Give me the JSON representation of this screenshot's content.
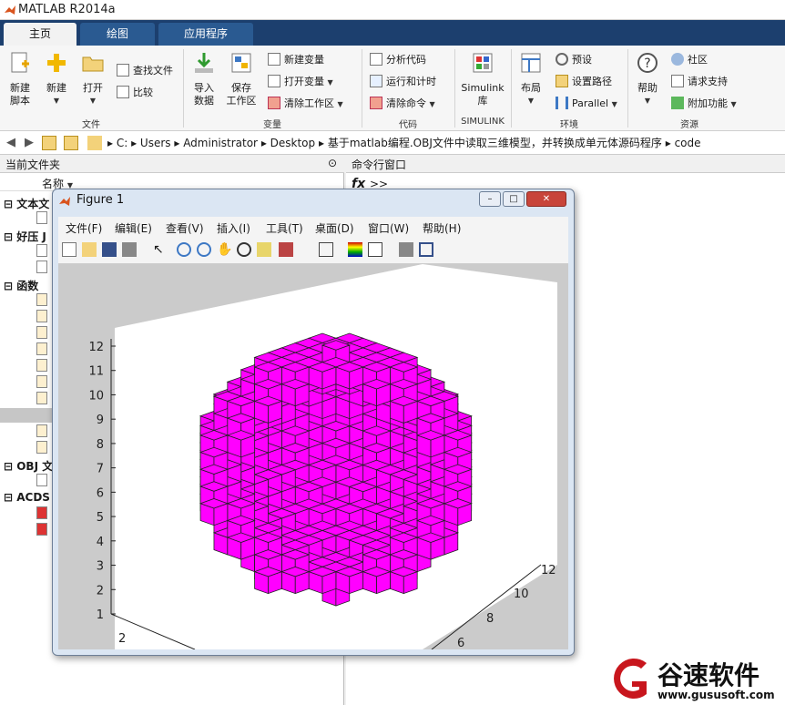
{
  "app": {
    "title": "MATLAB R2014a"
  },
  "tabs": [
    "主页",
    "绘图",
    "应用程序"
  ],
  "ribbon": {
    "file": {
      "new_script": "新建\n脚本",
      "new": "新建",
      "open": "打开",
      "find_files": "查找文件",
      "compare": "比较",
      "group": "文件"
    },
    "variable": {
      "import": "导入\n数据",
      "save_ws": "保存\n工作区",
      "new_var": "新建变量",
      "open_var": "打开变量",
      "clear_ws": "清除工作区",
      "group": "变量"
    },
    "code": {
      "analyze": "分析代码",
      "run_time": "运行和计时",
      "clear_cmd": "清除命令",
      "group": "代码"
    },
    "simulink": {
      "label": "Simulink\n库",
      "group": "SIMULINK"
    },
    "env": {
      "layout": "布局",
      "prefs": "预设",
      "set_path": "设置路径",
      "parallel": "Parallel",
      "group": "环境"
    },
    "resources": {
      "help": "帮助",
      "community": "社区",
      "request": "请求支持",
      "addons": "附加功能",
      "group": "资源"
    }
  },
  "address": {
    "crumbs": [
      "C:",
      "Users",
      "Administrator",
      "Desktop",
      "基于matlab编程.OBJ文件中读取三维模型，并转换成单元体源码程序",
      "code"
    ]
  },
  "left": {
    "title": "当前文件夹",
    "col": "名称",
    "sections": [
      "文本文",
      "好压 J",
      "函数",
      "OBJ 文",
      "ACDS"
    ],
    "bottom": "..."
  },
  "right": {
    "title": "命令行窗口",
    "prompt": ">>"
  },
  "figure": {
    "title": "Figure 1",
    "menu": [
      "文件(F)",
      "编辑(E)",
      "查看(V)",
      "插入(I)",
      "工具(T)",
      "桌面(D)",
      "窗口(W)",
      "帮助(H)"
    ]
  },
  "chart_data": {
    "type": "scatter",
    "title": "",
    "z_ticks": [
      "1",
      "2",
      "3",
      "4",
      "5",
      "6",
      "7",
      "8",
      "9",
      "10",
      "11",
      "12"
    ],
    "x_ticks": [
      "2"
    ],
    "y_ticks": [
      "6",
      "8",
      "10",
      "12"
    ],
    "zlim": [
      1,
      12
    ],
    "voxel_color": "#ff00ff",
    "shape": "sphere of unit voxels (voxelized OBJ model)"
  },
  "watermark": {
    "brand": "谷速软件",
    "url": "www.gususoft.com"
  },
  "colors": {
    "tab_bar": "#1c3f6e",
    "voxel": "#ff00ff",
    "watermark": "#c8161d"
  }
}
